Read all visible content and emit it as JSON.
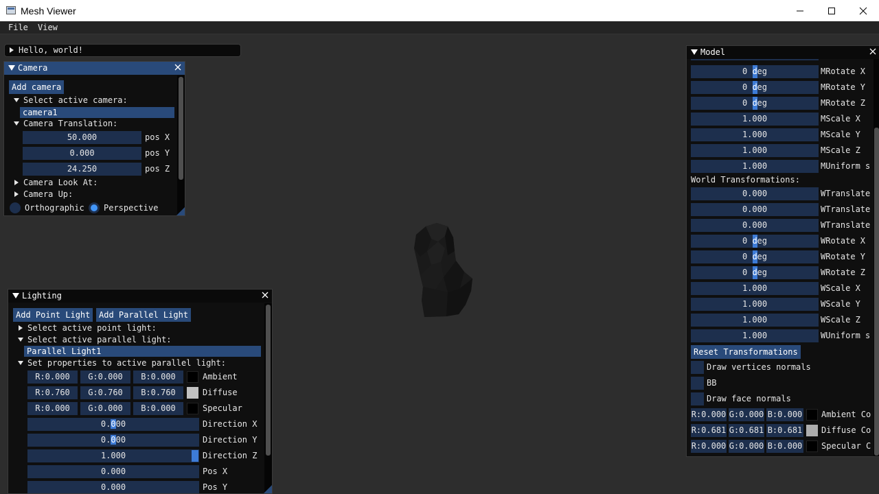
{
  "window": {
    "title": "Mesh Viewer"
  },
  "menu": {
    "file": "File",
    "view": "View"
  },
  "hello": {
    "label": "Hello, world!"
  },
  "camera": {
    "title": "Camera",
    "add_button": "Add camera",
    "select_active_label": "Select active camera:",
    "active_camera": "camera1",
    "translation_label": "Camera Translation:",
    "pos_x": {
      "value": "50.000",
      "label": "pos X"
    },
    "pos_y": {
      "value": "0.000",
      "label": "pos Y"
    },
    "pos_z": {
      "value": "24.250",
      "label": "pos Z"
    },
    "look_at_label": "Camera Look At:",
    "up_label": "Camera Up:",
    "orthographic": "Orthographic",
    "perspective": "Perspective",
    "projection_selected": "Perspective"
  },
  "lighting": {
    "title": "Lighting",
    "add_point": "Add Point Light",
    "add_parallel": "Add Parallel Light",
    "select_point_label": "Select active point light:",
    "select_parallel_label": "Select active parallel light:",
    "active_parallel": "Parallel Light1",
    "props_label": "Set properties to active parallel light:",
    "colors": [
      {
        "r": "R:0.000",
        "g": "G:0.000",
        "b": "B:0.000",
        "swatch": "#000000",
        "label": "Ambient"
      },
      {
        "r": "R:0.760",
        "g": "G:0.760",
        "b": "B:0.760",
        "swatch": "#c2c2c2",
        "label": "Diffuse"
      },
      {
        "r": "R:0.000",
        "g": "G:0.000",
        "b": "B:0.000",
        "swatch": "#000000",
        "label": "Specular"
      }
    ],
    "dir_x": {
      "pre": "0.",
      "hl": "0",
      "post": "00",
      "label": "Direction X"
    },
    "dir_y": {
      "pre": "0.",
      "hl": "0",
      "post": "00",
      "label": "Direction Y"
    },
    "dir_z": {
      "value": "1.000",
      "label": "Direction Z"
    },
    "pos_x": {
      "value": "0.000",
      "label": "Pos X"
    },
    "pos_y": {
      "value": "0.000",
      "label": "Pos Y"
    }
  },
  "model": {
    "title": "Model",
    "rows_top": [
      {
        "num": "0 ",
        "unit": "deg",
        "label": "MRotate X"
      },
      {
        "num": "0 ",
        "unit": "deg",
        "label": "MRotate Y"
      },
      {
        "num": "0 ",
        "unit": "deg",
        "label": "MRotate Z"
      }
    ],
    "scale_rows": [
      {
        "value": "1.000",
        "label": "MScale X"
      },
      {
        "value": "1.000",
        "label": "MScale Y"
      },
      {
        "value": "1.000",
        "label": "MScale Z"
      },
      {
        "value": "1.000",
        "label": "MUniform s"
      }
    ],
    "world_label": "World Transformations:",
    "world_translate": [
      {
        "value": "0.000",
        "label": "WTranslate"
      },
      {
        "value": "0.000",
        "label": "WTranslate"
      },
      {
        "value": "0.000",
        "label": "WTranslate"
      }
    ],
    "world_rotate": [
      {
        "num": "0 ",
        "unit": "deg",
        "label": "WRotate X"
      },
      {
        "num": "0 ",
        "unit": "deg",
        "label": "WRotate Y"
      },
      {
        "num": "0 ",
        "unit": "deg",
        "label": "WRotate Z"
      }
    ],
    "world_scale": [
      {
        "value": "1.000",
        "label": "WScale X"
      },
      {
        "value": "1.000",
        "label": "WScale Y"
      },
      {
        "value": "1.000",
        "label": "WScale Z"
      },
      {
        "value": "1.000",
        "label": "WUniform s"
      }
    ],
    "reset_button": "Reset Transformations",
    "check_vertex_normals": "Draw vertices normals",
    "check_bb": "BB",
    "check_face_normals": "Draw face normals",
    "colors": [
      {
        "r": "R:0.000",
        "g": "G:0.000",
        "b": "B:0.000",
        "swatch": "#000000",
        "label": "Ambient Co"
      },
      {
        "r": "R:0.681",
        "g": "G:0.681",
        "b": "B:0.681",
        "swatch": "#adadad",
        "label": "Diffuse Co"
      },
      {
        "r": "R:0.000",
        "g": "G:0.000",
        "b": "B:0.000",
        "swatch": "#000000",
        "label": "Specular C"
      }
    ]
  }
}
